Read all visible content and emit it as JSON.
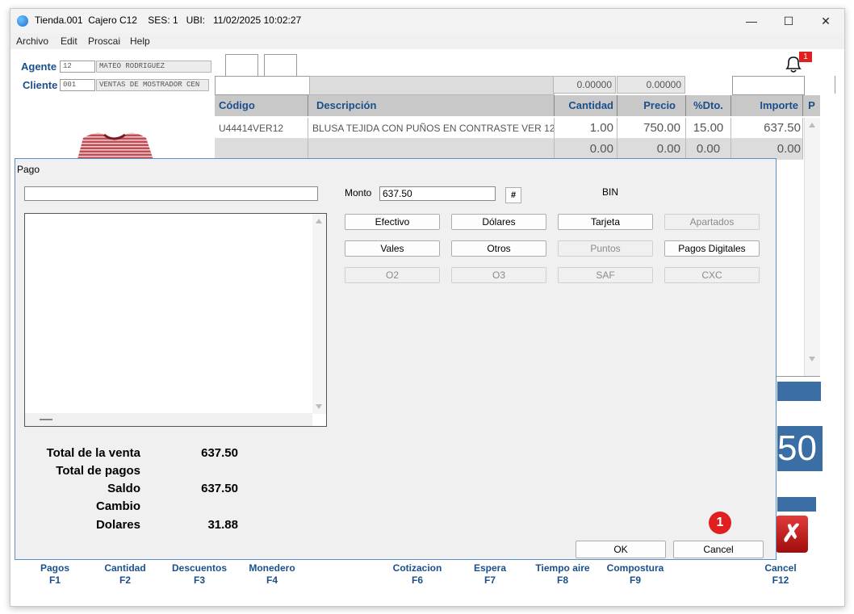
{
  "window": {
    "title": "Tienda.001  Cajero C12    SES: 1   UBI:   11/02/2025 10:02:27",
    "minimize": "—",
    "maximize": "☐",
    "close": "✕"
  },
  "menu": [
    "Archivo",
    "Edit",
    "Proscai",
    "Help"
  ],
  "header": {
    "agente_label": "Agente",
    "agente_code": "12",
    "agente_name": "MATEO RODRIGUEZ",
    "cliente_label": "Cliente",
    "cliente_code": "001",
    "cliente_name": "VENTAS DE MOSTRADOR CEN",
    "total_qty": "0.00000",
    "total_price": "0.00000",
    "notification_count": "1"
  },
  "table": {
    "columns": [
      "Código",
      "Descripción",
      "Cantidad",
      "Precio",
      "%Dto.",
      "Importe",
      "P"
    ],
    "rows": [
      {
        "codigo": "U44414VER12",
        "descripcion": "BLUSA TEJIDA CON PUÑOS EN CONTRASTE VER 12",
        "cantidad": "1.00",
        "precio": "750.00",
        "dto": "15.00",
        "importe": "637.50"
      },
      {
        "codigo": "",
        "descripcion": "",
        "cantidad": "0.00",
        "precio": "0.00",
        "dto": "0.00",
        "importe": "0.00"
      }
    ]
  },
  "big_total_fragment": "50",
  "function_keys": [
    {
      "label": "Pagos",
      "key": "F1"
    },
    {
      "label": "Cantidad",
      "key": "F2"
    },
    {
      "label": "Descuentos",
      "key": "F3"
    },
    {
      "label": "Monedero",
      "key": "F4"
    },
    {
      "label": "Cotizacion",
      "key": "F6"
    },
    {
      "label": "Espera",
      "key": "F7"
    },
    {
      "label": "Tiempo aire",
      "key": "F8"
    },
    {
      "label": "Compostura",
      "key": "F9"
    },
    {
      "label": "Cancel",
      "key": "F12"
    }
  ],
  "dialog": {
    "title": "Pago",
    "monto_label": "Monto",
    "monto_value": "637.50",
    "hash_button": "#",
    "bin_label": "BIN",
    "buttons": [
      {
        "label": "Efectivo",
        "enabled": true
      },
      {
        "label": "Dólares",
        "enabled": true
      },
      {
        "label": "Tarjeta",
        "enabled": true
      },
      {
        "label": "Apartados",
        "enabled": false
      },
      {
        "label": "Vales",
        "enabled": true
      },
      {
        "label": "Otros",
        "enabled": true
      },
      {
        "label": "Puntos",
        "enabled": false
      },
      {
        "label": "Pagos Digitales",
        "enabled": true
      },
      {
        "label": "O2",
        "enabled": false
      },
      {
        "label": "O3",
        "enabled": false
      },
      {
        "label": "SAF",
        "enabled": false
      },
      {
        "label": "CXC",
        "enabled": false
      }
    ],
    "summary": [
      {
        "label": "Total de la venta",
        "value": "637.50"
      },
      {
        "label": "Total de pagos",
        "value": ""
      },
      {
        "label": "Saldo",
        "value": "637.50"
      },
      {
        "label": "Cambio",
        "value": ""
      },
      {
        "label": "Dolares",
        "value": "31.88"
      }
    ],
    "ok_button": "OK",
    "cancel_button": "Cancel",
    "step_badge": "1"
  },
  "colors": {
    "accent_blue": "#1b4f8a",
    "panel_blue": "#3a6ea5",
    "badge_red": "#e02020"
  }
}
